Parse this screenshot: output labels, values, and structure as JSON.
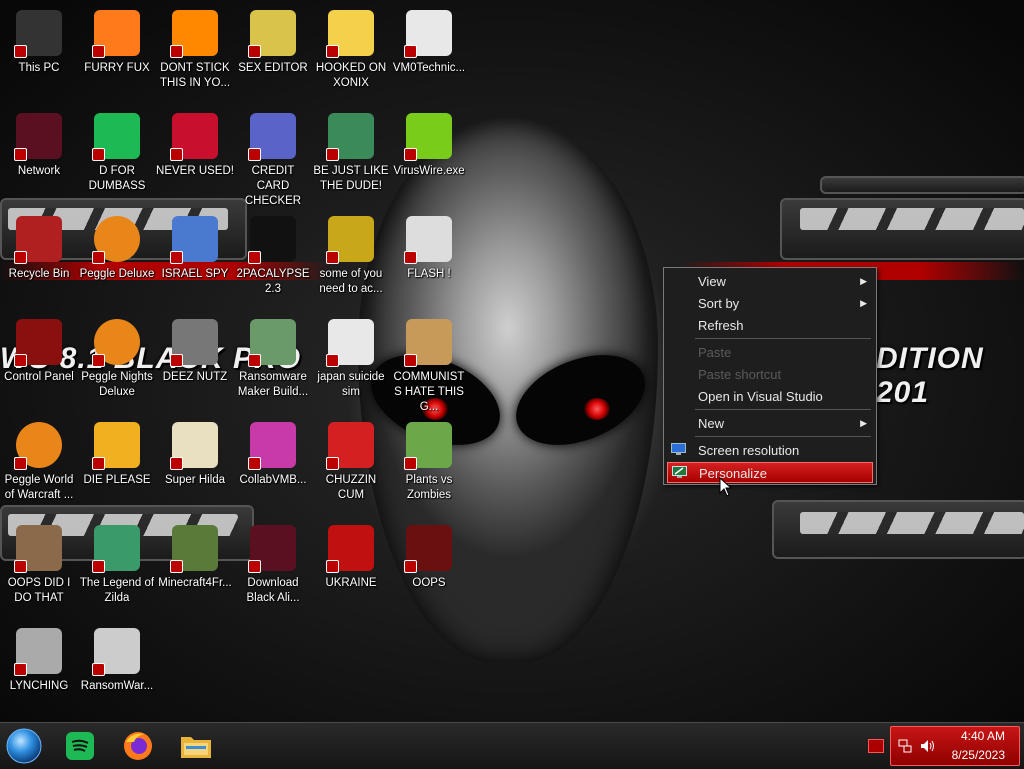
{
  "desktop": {
    "wallpaper_text_left": "WS 8.1 BLACK PRO",
    "wallpaper_text_right": "DITION 201",
    "icons": [
      {
        "label": "This PC",
        "icon": "computer-icon"
      },
      {
        "label": "FURRY FUX",
        "icon": "firefox-icon"
      },
      {
        "label": "DONT STICK THIS IN YO...",
        "icon": "vlc-cone-icon"
      },
      {
        "label": "SEX EDITOR",
        "icon": "hxd-icon"
      },
      {
        "label": "HOOKED ON XONIX",
        "icon": "cartoon-icon"
      },
      {
        "label": "VM0Technic...",
        "icon": "document-icon"
      },
      {
        "label": "Network",
        "icon": "alien-network-icon"
      },
      {
        "label": "D FOR DUMBASS",
        "icon": "spotify-icon"
      },
      {
        "label": "NEVER USED!",
        "icon": "devcpp-icon"
      },
      {
        "label": "CREDIT CARD CHECKER",
        "icon": "credit-card-icon"
      },
      {
        "label": "BE JUST LIKE THE DUDE!",
        "icon": "elf-icon"
      },
      {
        "label": "VirusWire.exe",
        "icon": "lime-icon"
      },
      {
        "label": "Recycle Bin",
        "icon": "recycle-bin-icon"
      },
      {
        "label": "Peggle Deluxe",
        "icon": "peggle-icon"
      },
      {
        "label": "ISRAEL SPY",
        "icon": "spy-icon"
      },
      {
        "label": "2PACALYPSE 2.3",
        "icon": "terminal-icon"
      },
      {
        "label": "some of you need to ac...",
        "icon": "beaver-icon"
      },
      {
        "label": "FLASH !",
        "icon": "flash-doc-icon"
      },
      {
        "label": "Control Panel",
        "icon": "control-panel-icon"
      },
      {
        "label": "Peggle Nights Deluxe",
        "icon": "peggle-icon"
      },
      {
        "label": "DEEZ NUTZ",
        "icon": "window-stack-icon"
      },
      {
        "label": "Ransomware Maker Build...",
        "icon": "app-window-icon"
      },
      {
        "label": "japan suicide sim",
        "icon": "document-icon"
      },
      {
        "label": "COMMUNISTS HATE THIS G...",
        "icon": "money-bag-icon"
      },
      {
        "label": "Peggle World of Warcraft ...",
        "icon": "peggle-icon"
      },
      {
        "label": "DIE PLEASE",
        "icon": "de-icon"
      },
      {
        "label": "Super Hilda",
        "icon": "pixel-cat-icon"
      },
      {
        "label": "CollabVMB...",
        "icon": "collab-icon"
      },
      {
        "label": "CHUZZIN CUM",
        "icon": "chuzzle-icon"
      },
      {
        "label": "Plants vs Zombies",
        "icon": "flower-icon"
      },
      {
        "label": "OOPS DID I DO THAT",
        "icon": "portrait-icon"
      },
      {
        "label": "The Legend of Zilda",
        "icon": "zelda-icon"
      },
      {
        "label": "Minecraft4Fr...",
        "icon": "grass-block-icon"
      },
      {
        "label": "Download Black Ali...",
        "icon": "alien-network-icon"
      },
      {
        "label": "UKRAINE",
        "icon": "radiation-icon"
      },
      {
        "label": "OOPS",
        "icon": "red-app-icon"
      },
      {
        "label": "LYNCHING",
        "icon": "noose-icon"
      },
      {
        "label": "RansomWar...",
        "icon": "skull-icon"
      }
    ]
  },
  "context_menu": {
    "view": "View",
    "sort_by": "Sort by",
    "refresh": "Refresh",
    "paste": "Paste",
    "paste_shortcut": "Paste shortcut",
    "open_vs": "Open in Visual Studio",
    "new": "New",
    "screen_resolution": "Screen resolution",
    "personalize": "Personalize",
    "submenu_arrow": "▶"
  },
  "taskbar": {
    "apps": [
      "start-orb-icon",
      "spotify-icon",
      "firefox-icon",
      "file-explorer-icon"
    ],
    "clock_time": "4:40 AM",
    "clock_date": "8/25/2023"
  },
  "colors": {
    "accent": "#c81515",
    "menu_bg": "#1e1e1e"
  }
}
